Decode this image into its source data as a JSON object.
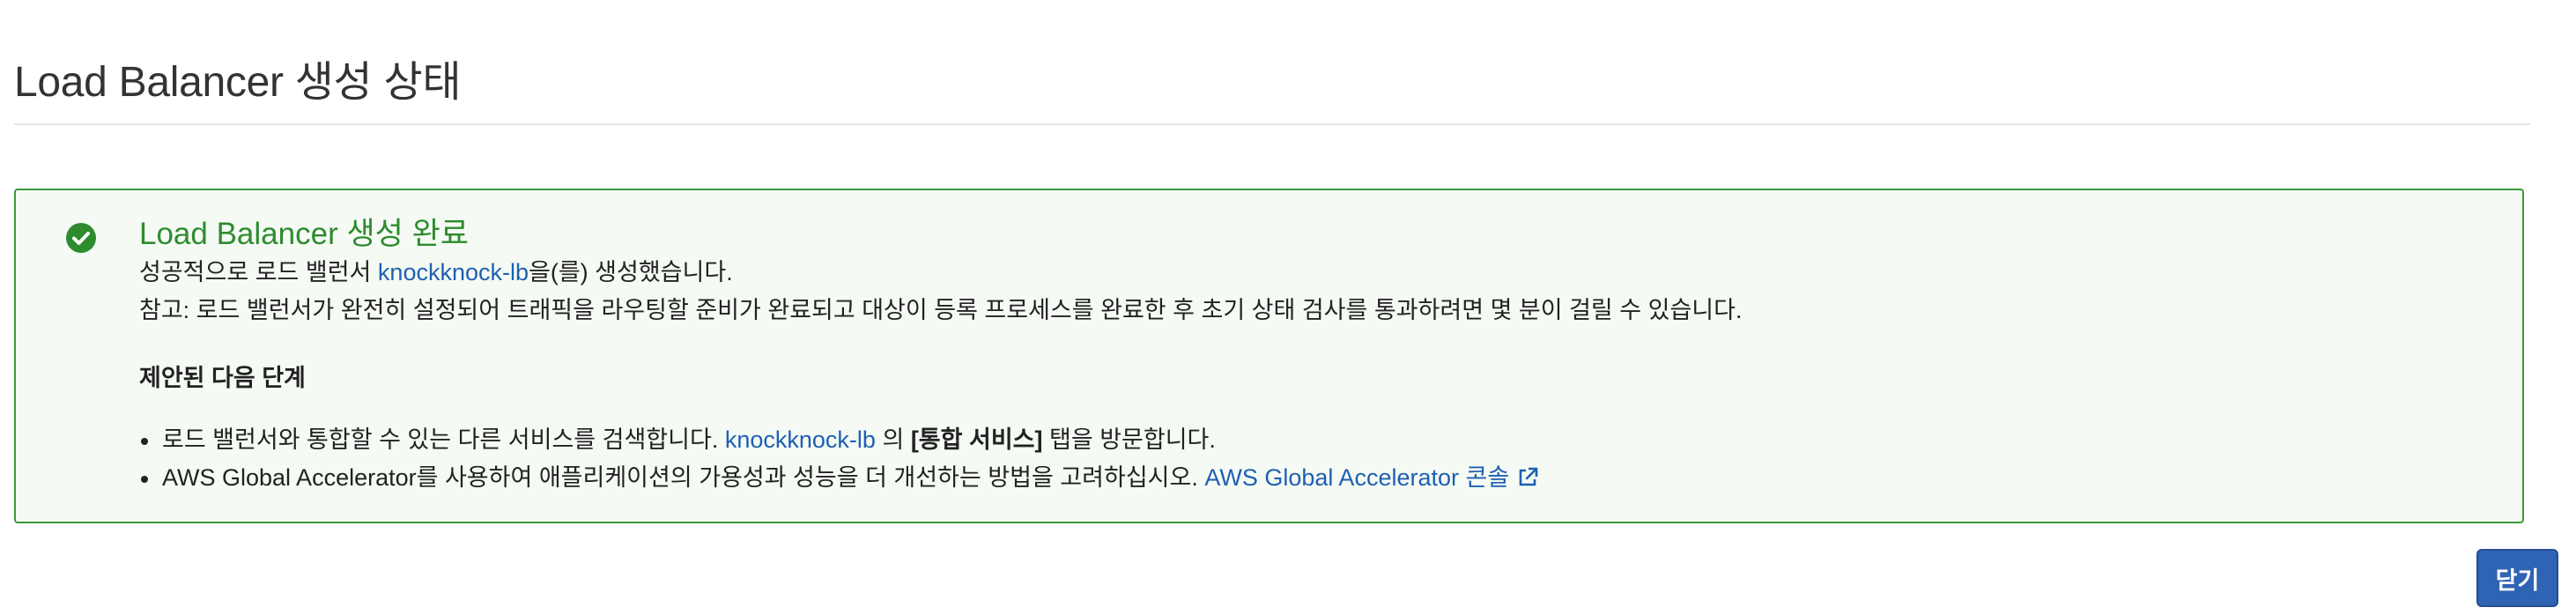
{
  "page": {
    "title": "Load Balancer 생성 상태"
  },
  "status": {
    "title": "Load Balancer 생성 완료",
    "success_prefix": "성공적으로 로드 밸런서",
    "lb_name": "knockknock-lb",
    "success_suffix": "을(를) 생성했습니다.",
    "note": "참고: 로드 밸런서가 완전히 설정되어 트래픽을 라우팅할 준비가 완료되고 대상이 등록 프로세스를 완료한 후 초기 상태 검사를 통과하려면 몇 분이 걸릴 수 있습니다.",
    "color": "#2e8b2e"
  },
  "next_steps": {
    "heading": "제안된 다음 단계",
    "step1_prefix": "로드 밸런서와 통합할 수 있는 다른 서비스를 검색합니다.",
    "step1_link": "knockknock-lb",
    "step1_mid": "의",
    "step1_tab": "[통합 서비스]",
    "step1_suffix": "탭을 방문합니다.",
    "step2_text": "AWS Global Accelerator를 사용하여 애플리케이션의 가용성과 성능을 더 개선하는 방법을 고려하십시오.",
    "step2_link": "AWS Global Accelerator 콘솔"
  },
  "actions": {
    "close_label": "닫기"
  },
  "icons": {
    "status": "check-circle-icon",
    "external": "external-link-icon"
  }
}
